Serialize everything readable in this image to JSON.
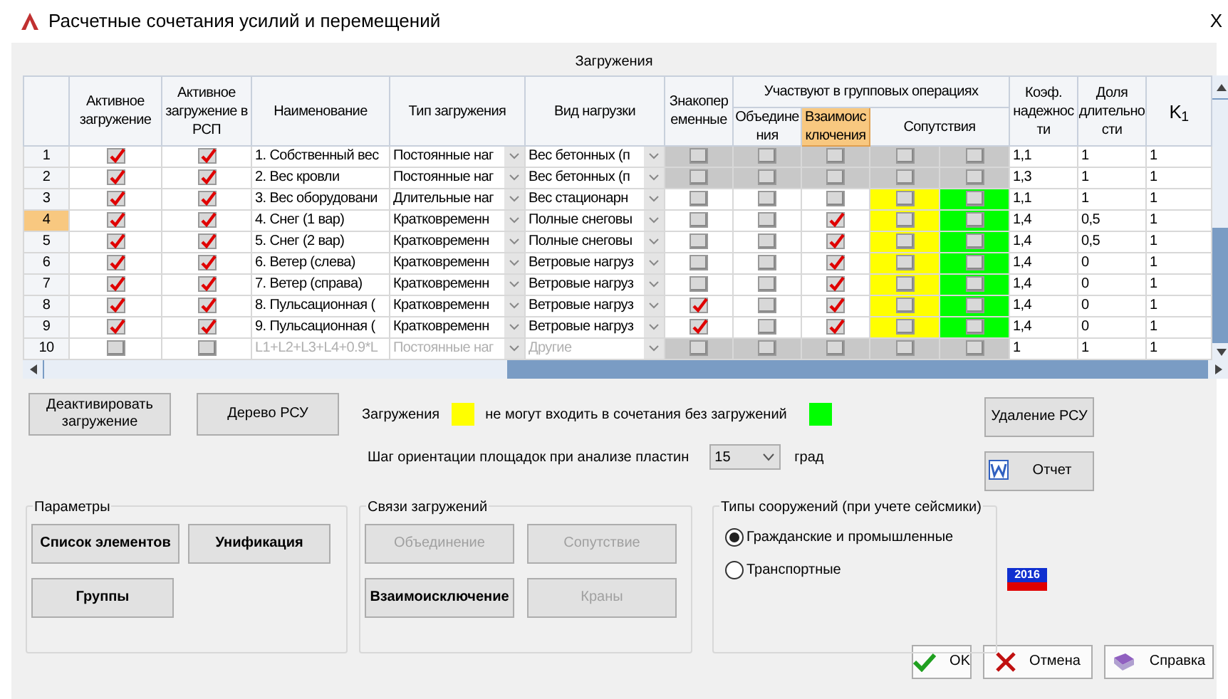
{
  "window": {
    "title": "Расчетные сочетания усилий и перемещений",
    "close": "X"
  },
  "table": {
    "caption": "Загружения",
    "columns": [
      {
        "label": "Активное загружение",
        "selected": false
      },
      {
        "label": "Активное загружение в РСП",
        "selected": false
      },
      {
        "label": "Наименование",
        "selected": false
      },
      {
        "label": "Тип загружения",
        "selected": false
      },
      {
        "label": "Вид нагрузки",
        "selected": false
      },
      {
        "label": "Знакопеременные",
        "selected": false
      },
      {
        "label": "Участвуют в групповых операциях",
        "selected": false
      },
      {
        "label": "Объединения",
        "selected": false
      },
      {
        "label": "Взаимоисключения",
        "selected": true
      },
      {
        "label": "Сопутствия",
        "selected": false
      },
      {
        "label": "Коэф. надежности",
        "selected": false
      },
      {
        "label": "Доля длительности",
        "selected": false
      },
      {
        "label": "K$_{1}$",
        "selected": false
      }
    ],
    "rows": [
      {
        "number": "1",
        "selected": false,
        "disabled": false,
        "group_locked": true,
        "accompany_highlighted": false,
        "active": true,
        "active_rsp": true,
        "name": "1. Собственный вес",
        "type": "Постоянные наг",
        "load": "Вес бетонных (п",
        "alternating": false,
        "union": false,
        "exclusion": false,
        "acc1": false,
        "acc2": false,
        "reliability": "1,1",
        "duration": "1",
        "k1": "1"
      },
      {
        "number": "2",
        "selected": false,
        "disabled": false,
        "group_locked": true,
        "accompany_highlighted": false,
        "active": true,
        "active_rsp": true,
        "name": "2. Вес кровли",
        "type": "Постоянные наг",
        "load": "Вес бетонных (п",
        "alternating": false,
        "union": false,
        "exclusion": false,
        "acc1": false,
        "acc2": false,
        "reliability": "1,3",
        "duration": "1",
        "k1": "1"
      },
      {
        "number": "3",
        "selected": false,
        "disabled": false,
        "group_locked": false,
        "accompany_highlighted": true,
        "active": true,
        "active_rsp": true,
        "name": "3. Вес оборудовани",
        "type": "Длительные наг",
        "load": "Вес стационарн",
        "alternating": false,
        "union": false,
        "exclusion": false,
        "acc1": false,
        "acc2": false,
        "reliability": "1,1",
        "duration": "1",
        "k1": "1"
      },
      {
        "number": "4",
        "selected": true,
        "disabled": false,
        "group_locked": false,
        "accompany_highlighted": true,
        "active": true,
        "active_rsp": true,
        "name": "4. Снег (1 вар)",
        "type": "Кратковременн",
        "load": "Полные снеговы",
        "alternating": false,
        "union": false,
        "exclusion": true,
        "acc1": false,
        "acc2": false,
        "reliability": "1,4",
        "duration": "0,5",
        "k1": "1"
      },
      {
        "number": "5",
        "selected": false,
        "disabled": false,
        "group_locked": false,
        "accompany_highlighted": true,
        "active": true,
        "active_rsp": true,
        "name": "5. Снег (2 вар)",
        "type": "Кратковременн",
        "load": "Полные снеговы",
        "alternating": false,
        "union": false,
        "exclusion": true,
        "acc1": false,
        "acc2": false,
        "reliability": "1,4",
        "duration": "0,5",
        "k1": "1"
      },
      {
        "number": "6",
        "selected": false,
        "disabled": false,
        "group_locked": false,
        "accompany_highlighted": true,
        "active": true,
        "active_rsp": true,
        "name": "6. Ветер (слева)",
        "type": "Кратковременн",
        "load": "Ветровые нагруз",
        "alternating": false,
        "union": false,
        "exclusion": true,
        "acc1": false,
        "acc2": false,
        "reliability": "1,4",
        "duration": "0",
        "k1": "1"
      },
      {
        "number": "7",
        "selected": false,
        "disabled": false,
        "group_locked": false,
        "accompany_highlighted": true,
        "active": true,
        "active_rsp": true,
        "name": "7. Ветер (справа)",
        "type": "Кратковременн",
        "load": "Ветровые нагруз",
        "alternating": false,
        "union": false,
        "exclusion": true,
        "acc1": false,
        "acc2": false,
        "reliability": "1,4",
        "duration": "0",
        "k1": "1"
      },
      {
        "number": "8",
        "selected": false,
        "disabled": false,
        "group_locked": false,
        "accompany_highlighted": true,
        "active": true,
        "active_rsp": true,
        "name": "8. Пульсационная (",
        "type": "Кратковременн",
        "load": "Ветровые нагруз",
        "alternating": true,
        "union": false,
        "exclusion": true,
        "acc1": false,
        "acc2": false,
        "reliability": "1,4",
        "duration": "0",
        "k1": "1"
      },
      {
        "number": "9",
        "selected": false,
        "disabled": false,
        "group_locked": false,
        "accompany_highlighted": true,
        "active": true,
        "active_rsp": true,
        "name": "9. Пульсационная (",
        "type": "Кратковременн",
        "load": "Ветровые нагруз",
        "alternating": true,
        "union": false,
        "exclusion": true,
        "acc1": false,
        "acc2": false,
        "reliability": "1,4",
        "duration": "0",
        "k1": "1"
      },
      {
        "number": "10",
        "selected": false,
        "disabled": true,
        "group_locked": true,
        "accompany_highlighted": false,
        "active": false,
        "active_rsp": false,
        "name": "L1+L2+L3+L4+0.9*L",
        "type": "Постоянные наг",
        "load": "Другие",
        "alternating": false,
        "union": false,
        "exclusion": false,
        "acc1": false,
        "acc2": false,
        "reliability": "1",
        "duration": "1",
        "k1": "1"
      }
    ]
  },
  "buttons_top": [
    {
      "label": "Деактивировать загружение"
    },
    {
      "label": "Дерево РСУ"
    }
  ],
  "legend": [
    {
      "text": "Загружения",
      "color": "#ffff00"
    },
    {
      "text": "не могут входить в сочетания без загружений",
      "color": "#00ff00"
    }
  ],
  "step": {
    "label": "Шаг ориентации площадок при анализе пластин",
    "value": "15",
    "unit": "град"
  },
  "buttons_right": [
    {
      "label": "Удаление РСУ",
      "kind": "plain"
    },
    {
      "label": "Отчет",
      "kind": "report"
    }
  ],
  "groups": [
    {
      "title": "Параметры",
      "buttons": [
        {
          "label": "Список элементов",
          "disabled": false
        },
        {
          "label": "Унификация",
          "disabled": false
        },
        {
          "label": "Группы",
          "disabled": false
        }
      ]
    },
    {
      "title": "Связи загружений",
      "buttons": [
        {
          "label": "Объединение",
          "disabled": true
        },
        {
          "label": "Сопутствие",
          "disabled": true
        },
        {
          "label": "Взаимоисключение",
          "disabled": false
        },
        {
          "label": "Краны",
          "disabled": true
        }
      ]
    }
  ],
  "structure_types": {
    "title": "Типы сооружений (при учете сейсмики)",
    "options": [
      {
        "label": "Гражданские и промышленные",
        "selected": true
      },
      {
        "label": "Транспортные",
        "selected": false
      }
    ]
  },
  "norm_badge": "2016",
  "dialog_buttons": [
    {
      "label": "OK",
      "kind": "ok"
    },
    {
      "label": "Отмена",
      "kind": "cancel"
    },
    {
      "label": "Справка",
      "kind": "help"
    }
  ]
}
